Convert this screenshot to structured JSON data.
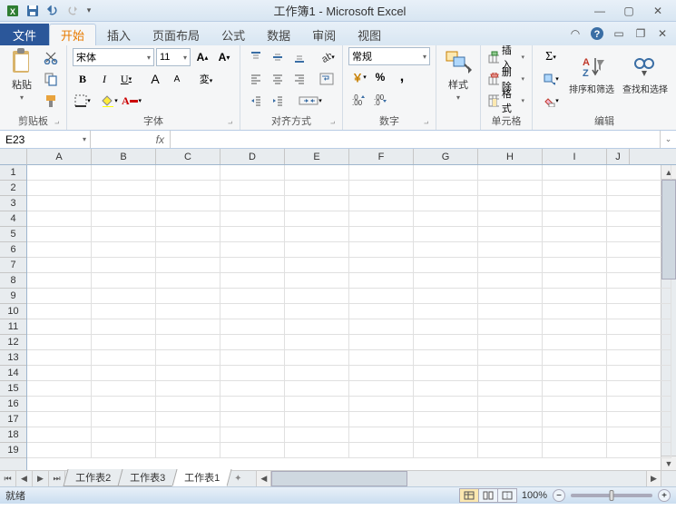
{
  "title": "工作簿1 - Microsoft Excel",
  "tabs": {
    "file": "文件",
    "items": [
      "开始",
      "插入",
      "页面布局",
      "公式",
      "数据",
      "审阅",
      "视图"
    ],
    "active": "开始"
  },
  "ribbon": {
    "clipboard": {
      "label": "剪贴板",
      "paste": "粘贴"
    },
    "font": {
      "label": "字体",
      "name": "宋体",
      "size": "11"
    },
    "alignment": {
      "label": "对齐方式"
    },
    "number": {
      "label": "数字",
      "format": "常规"
    },
    "styles": {
      "label": "样式",
      "style_btn": "样式"
    },
    "cells": {
      "label": "单元格",
      "insert": "插入",
      "delete": "删除",
      "format": "格式"
    },
    "editing": {
      "label": "编辑",
      "sort": "排序和筛选",
      "find": "查找和选择"
    }
  },
  "fbar": {
    "namebox": "E23",
    "fx": "fx",
    "formula": ""
  },
  "columns": [
    "A",
    "B",
    "C",
    "D",
    "E",
    "F",
    "G",
    "H",
    "I",
    "J"
  ],
  "rows_visible": 19,
  "sheets": {
    "items": [
      "工作表2",
      "工作表3",
      "工作表1"
    ],
    "active": "工作表1"
  },
  "status": {
    "text": "就绪",
    "zoom": "100%"
  }
}
